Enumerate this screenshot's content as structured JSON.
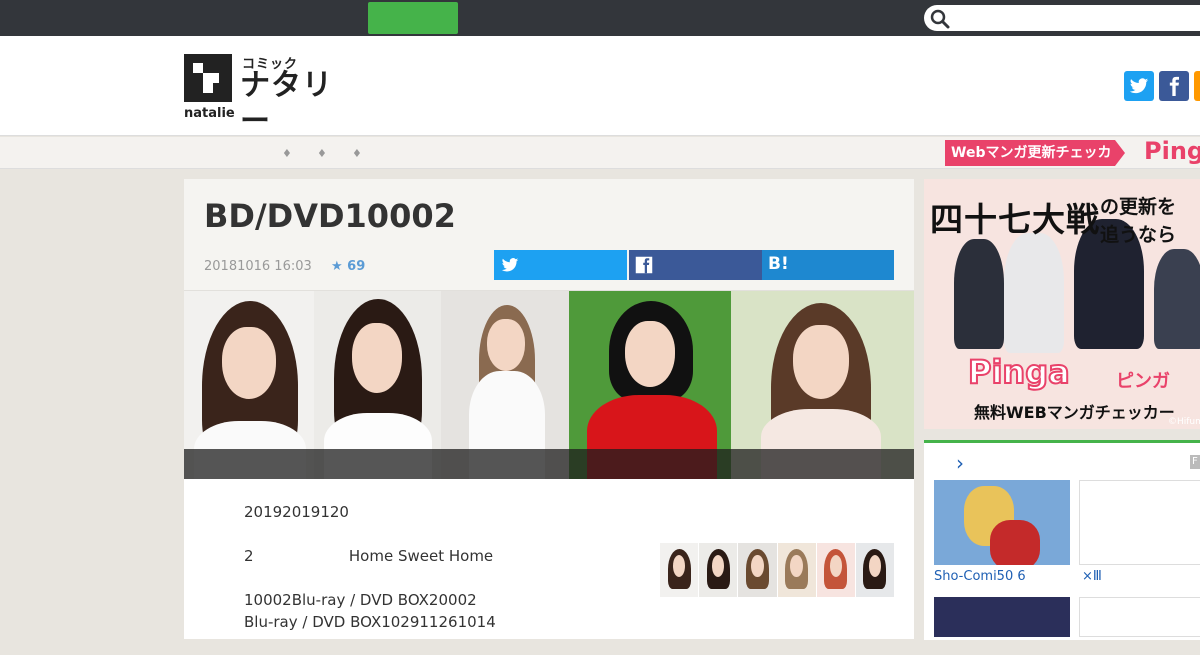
{
  "header": {
    "logo_sub": "コミック",
    "logo_main": "ナタリー",
    "logo_brand": "natalie"
  },
  "nav": {
    "banner_text": "Webマンガ更新チェッカー",
    "banner_logo": "Ping"
  },
  "article": {
    "title": "BD/DVD10002",
    "date": "20181016 16:03",
    "stars": "★ 69",
    "hatena_label": "B!",
    "body": [
      "20192019120",
      "2                    Home Sweet Home",
      "10002Blu-ray / DVD BOX20002\nBlu-ray / DVD BOX102911261014"
    ]
  },
  "sidebar": {
    "ad": {
      "title": "四十七大戦",
      "subtitle_1": "の更新を",
      "subtitle_2": "追うなら",
      "pinga": "Pinga",
      "pinga_jp": "ピンガ",
      "free_text": "無料WEBマンガチェッカー",
      "copyright": "©Hifum"
    },
    "ranking": {
      "chevron": "›",
      "badge": "F",
      "items": [
        {
          "label": "Sho-Comi50 6"
        },
        {
          "label": "×Ⅲ"
        }
      ]
    }
  },
  "colors": {
    "topbar": "#33363b",
    "green": "#45b34a",
    "twitter": "#1da1f2",
    "facebook": "#3b5998",
    "hatena": "#1e88d0",
    "pinga_pink": "#e9426a",
    "link_blue": "#1e5fb3"
  }
}
